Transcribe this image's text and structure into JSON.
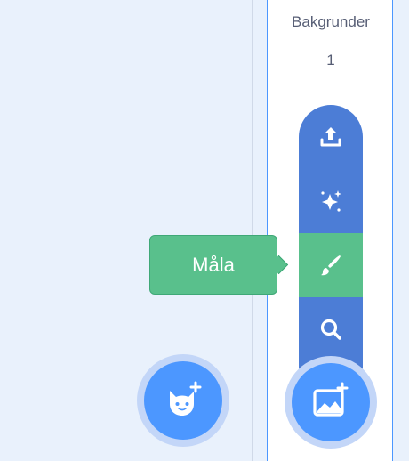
{
  "stage": {
    "title": "Bakgrunder",
    "count": "1"
  },
  "backdrop_menu": {
    "items": [
      {
        "icon": "upload-icon"
      },
      {
        "icon": "sparkle-icon"
      },
      {
        "icon": "paintbrush-icon",
        "active": true
      },
      {
        "icon": "search-icon"
      }
    ],
    "tooltip": "Måla"
  },
  "fab_sprite": {
    "icon": "cat-plus-icon"
  },
  "fab_backdrop": {
    "icon": "image-plus-icon"
  },
  "colors": {
    "accent": "#4c97ff",
    "menu_blue": "#4c7dd6",
    "highlight_green": "#59c08c",
    "panel_bg": "#e9f1fc"
  }
}
